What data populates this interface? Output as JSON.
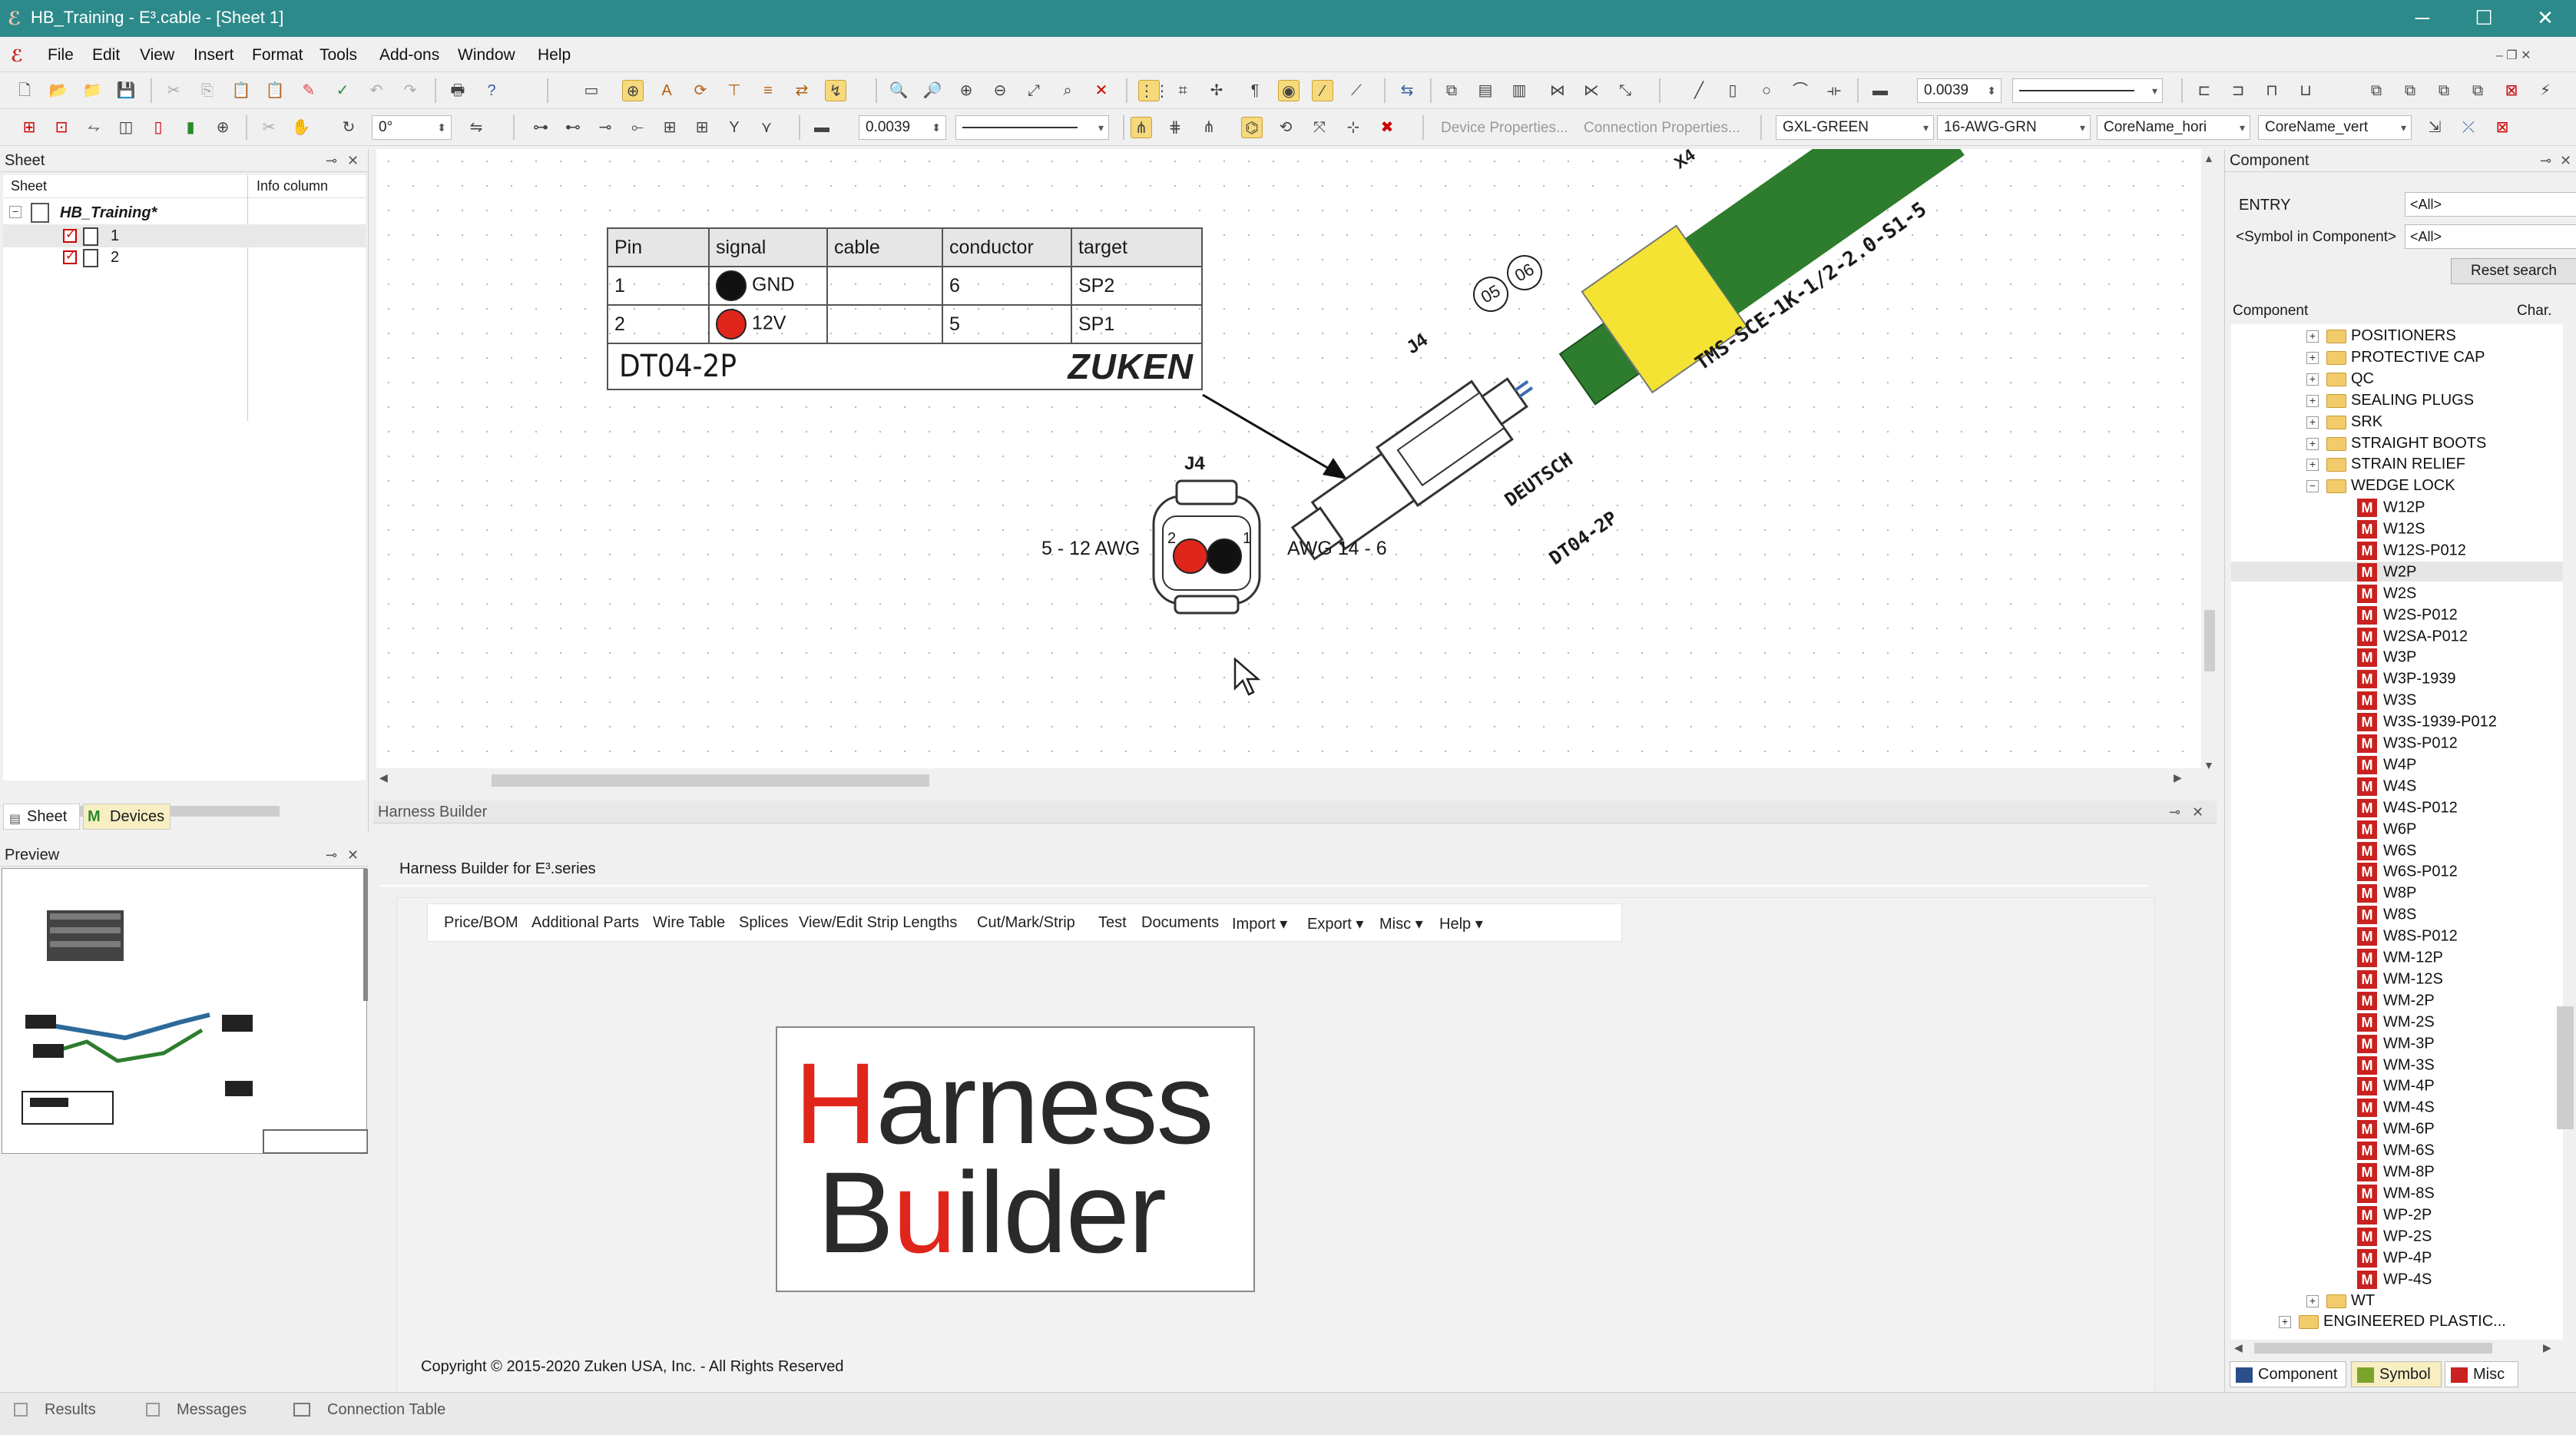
{
  "window": {
    "title": "HB_Training - E³.cable - [Sheet 1]",
    "minimize": "─",
    "maximize": "☐",
    "close": "✕"
  },
  "menu": [
    "File",
    "Edit",
    "View",
    "Insert",
    "Format",
    "Tools",
    "Add-ons",
    "Window",
    "Help"
  ],
  "toolbar": {
    "grid_value_1": "0.0039",
    "grid_value_2": "0.0039",
    "rotation": "0°",
    "device_properties": "Device Properties...",
    "connection_properties": "Connection Properties...",
    "wire_color": "GXL-GREEN",
    "wire_type": "16-AWG-GRN",
    "core_name_hori": "CoreName_hori",
    "core_name_vert": "CoreName_vert"
  },
  "sheet_panel": {
    "title": "Sheet",
    "col_sheet": "Sheet",
    "col_info": "Info column",
    "project": "HB_Training*",
    "sheets": [
      "1",
      "2"
    ],
    "tab_sheet": "Sheet",
    "tab_devices": "Devices"
  },
  "preview_panel": {
    "title": "Preview"
  },
  "drawing": {
    "table": {
      "headers": [
        "Pin",
        "signal",
        "cable",
        "conductor",
        "target"
      ],
      "rows": [
        {
          "pin": "1",
          "color": "#111111",
          "signal": "GND",
          "cable": "",
          "conductor": "6",
          "target": "SP2"
        },
        {
          "pin": "2",
          "color": "#e0261b",
          "signal": "12V",
          "cable": "",
          "conductor": "5",
          "target": "SP1"
        }
      ],
      "footer_part": "DT04-2P",
      "logo": "ZUKEN"
    },
    "connector_label": "J4",
    "connector_label_rotated": "J4",
    "left_awg": "5 - 12 AWG",
    "right_awg": "AWG 14 - 6",
    "pin_left": "2",
    "pin_right": "1",
    "brand_text": "DEUTSCH",
    "part_text": "DT04-2P",
    "cable_text": "TMS-SCE-1K-1/2-2.0-S1-5",
    "bubble_1": "05",
    "bubble_2": "06",
    "top_label": "X4"
  },
  "harness_builder": {
    "panel_title": "Harness Builder",
    "subtitle": "Harness Builder for E³.series",
    "menu": [
      "Price/BOM",
      "Additional Parts",
      "Wire Table",
      "Splices",
      "View/Edit Strip Lengths",
      "Cut/Mark/Strip",
      "Test",
      "Documents",
      "Import ▾",
      "Export ▾",
      "Misc ▾",
      "Help ▾"
    ],
    "logo_line1_a": "H",
    "logo_line1_b": "arness",
    "logo_line2_a": "B",
    "logo_line2_b": "u",
    "logo_line2_c": "ilder",
    "copyright": "Copyright © 2015-2020 Zuken USA, Inc. - All Rights Reserved"
  },
  "component_panel": {
    "title": "Component",
    "entry_label": "ENTRY",
    "entry_value": "<All>",
    "symbol_label": "<Symbol in Component>",
    "symbol_value": "<All>",
    "reset_button": "Reset search",
    "col_component": "Component",
    "col_char": "Char.",
    "folders": [
      "POSITIONERS",
      "PROTECTIVE CAP",
      "QC",
      "SEALING PLUGS",
      "SRK",
      "STRAIGHT BOOTS",
      "STRAIN RELIEF"
    ],
    "open_folder": "WEDGE LOCK",
    "items": [
      "W12P",
      "W12S",
      "W12S-P012",
      "W2P",
      "W2S",
      "W2S-P012",
      "W2SA-P012",
      "W3P",
      "W3P-1939",
      "W3S",
      "W3S-1939-P012",
      "W3S-P012",
      "W4P",
      "W4S",
      "W4S-P012",
      "W6P",
      "W6S",
      "W6S-P012",
      "W8P",
      "W8S",
      "W8S-P012",
      "WM-12P",
      "WM-12S",
      "WM-2P",
      "WM-2S",
      "WM-3P",
      "WM-3S",
      "WM-4P",
      "WM-4S",
      "WM-6P",
      "WM-6S",
      "WM-8P",
      "WM-8S",
      "WP-2P",
      "WP-2S",
      "WP-4P",
      "WP-4S"
    ],
    "selected_item": "W2P",
    "after_folders": [
      "WT",
      "ENGINEERED PLASTIC..."
    ],
    "tab_component": "Component",
    "tab_symbol": "Symbol",
    "tab_misc": "Misc"
  },
  "bottom_tabs": [
    "Results",
    "Messages",
    "Connection Table"
  ],
  "colors": {
    "titlebar": "#2d8a8a",
    "accent_red": "#e0261b",
    "connector_yellow": "#f4e333",
    "cable_green": "#2e7d2e"
  }
}
